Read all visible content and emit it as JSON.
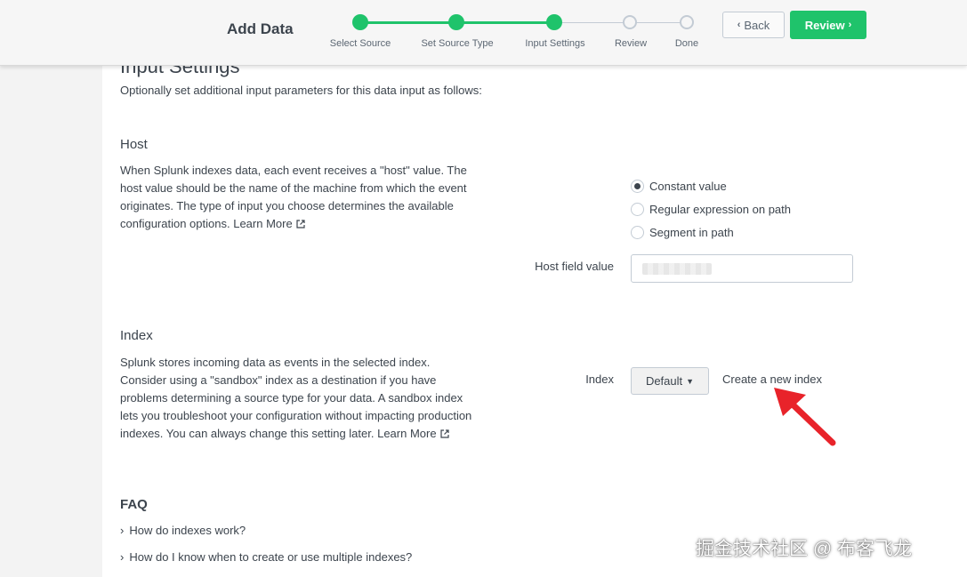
{
  "header": {
    "title": "Add Data",
    "steps": [
      {
        "label": "Select Source",
        "status": "done"
      },
      {
        "label": "Set Source Type",
        "status": "done"
      },
      {
        "label": "Input Settings",
        "status": "current"
      },
      {
        "label": "Review",
        "status": "todo"
      },
      {
        "label": "Done",
        "status": "todo"
      }
    ],
    "back_label": "Back",
    "review_label": "Review",
    "accent_color": "#1fc36b"
  },
  "input_settings": {
    "heading": "Input Settings",
    "intro": "Optionally set additional input parameters for this data input as follows:"
  },
  "host": {
    "heading": "Host",
    "description": "When Splunk indexes data, each event receives a \"host\" value. The host value should be the name of the machine from which the event originates. The type of input you choose determines the available configuration options.",
    "learn_more": "Learn More",
    "options": [
      {
        "label": "Constant value",
        "checked": true
      },
      {
        "label": "Regular expression on path",
        "checked": false
      },
      {
        "label": "Segment in path",
        "checked": false
      }
    ],
    "field_label": "Host field value"
  },
  "index": {
    "heading": "Index",
    "description": "Splunk stores incoming data as events in the selected index. Consider using a \"sandbox\" index as a destination if you have problems determining a source type for your data. A sandbox index lets you troubleshoot your configuration without impacting production indexes. You can always change this setting later.",
    "learn_more": "Learn More",
    "field_label": "Index",
    "selected": "Default",
    "create_link": "Create a new index"
  },
  "faq": {
    "heading": "FAQ",
    "items": [
      "How do indexes work?",
      "How do I know when to create or use multiple indexes?"
    ]
  },
  "watermark": "掘金技术社区 @ 布客飞龙"
}
